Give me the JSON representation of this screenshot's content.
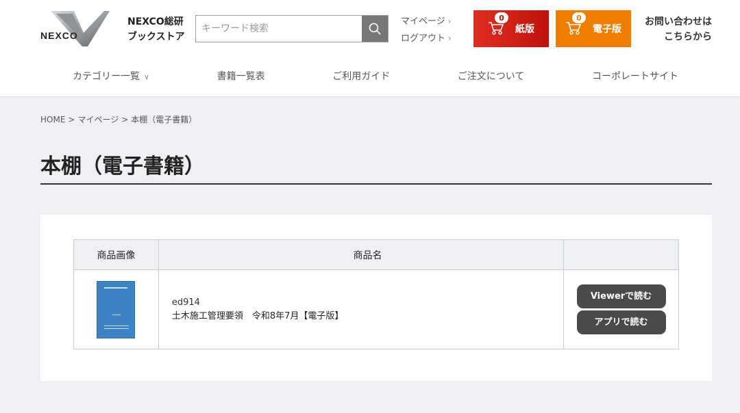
{
  "header": {
    "logo_text": "NEXCO",
    "brand_line1": "NEXCO総研",
    "brand_line2": "ブックストア",
    "search_placeholder": "キーワード検索",
    "account_links": [
      "マイページ",
      "ログアウト"
    ],
    "cart_paper": {
      "count": "0",
      "label": "紙版",
      "color": "#d21f18"
    },
    "cart_ebook": {
      "count": "0",
      "label": "電子版",
      "color": "#ef7d00"
    },
    "contact_line1": "お問い合わせは",
    "contact_line2": "こちらから"
  },
  "nav": [
    "カテゴリー一覧",
    "書籍一覧表",
    "ご利用ガイド",
    "ご注文について",
    "コーポレートサイト"
  ],
  "breadcrumb": [
    "HOME",
    "マイページ",
    "本棚（電子書籍）"
  ],
  "page_title": "本棚（電子書籍）",
  "table": {
    "headers": [
      "商品画像",
      "商品名",
      ""
    ],
    "rows": [
      {
        "code": "ed914",
        "name": "土木施工管理要領　令和8年7月【電子版】",
        "actions": [
          "Viewerで読む",
          "アプリで読む"
        ]
      }
    ]
  }
}
